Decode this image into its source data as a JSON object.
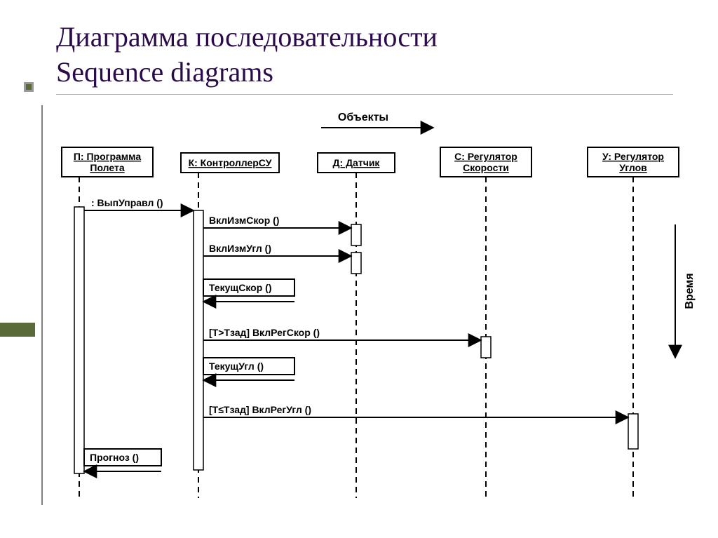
{
  "title_line1": "Диаграмма последовательности",
  "title_line2": "Sequence diagrams",
  "header_label": "Объекты",
  "time_label": "Время",
  "lifelines": [
    {
      "id": "P",
      "label1": "П: Программа",
      "label2": "Полета"
    },
    {
      "id": "K",
      "label1": "К: КонтроллерСУ",
      "label2": ""
    },
    {
      "id": "D",
      "label1": "Д: Датчик",
      "label2": ""
    },
    {
      "id": "C",
      "label1": "С: Регулятор",
      "label2": "Скорости"
    },
    {
      "id": "U",
      "label1": "У: Регулятор",
      "label2": "Углов"
    }
  ],
  "messages": [
    {
      "text": ": ВыпУправл ()"
    },
    {
      "text": "ВклИзмСкор ()"
    },
    {
      "text": "ВклИзмУгл ()"
    },
    {
      "text": "ТекущСкор ()"
    },
    {
      "text": "[Т>Тзад] ВклРегСкор ()"
    },
    {
      "text": "ТекущУгл ()"
    },
    {
      "text": "[Т≤Тзад] ВклРегУгл ()"
    },
    {
      "text": "Прогноз ()"
    }
  ]
}
